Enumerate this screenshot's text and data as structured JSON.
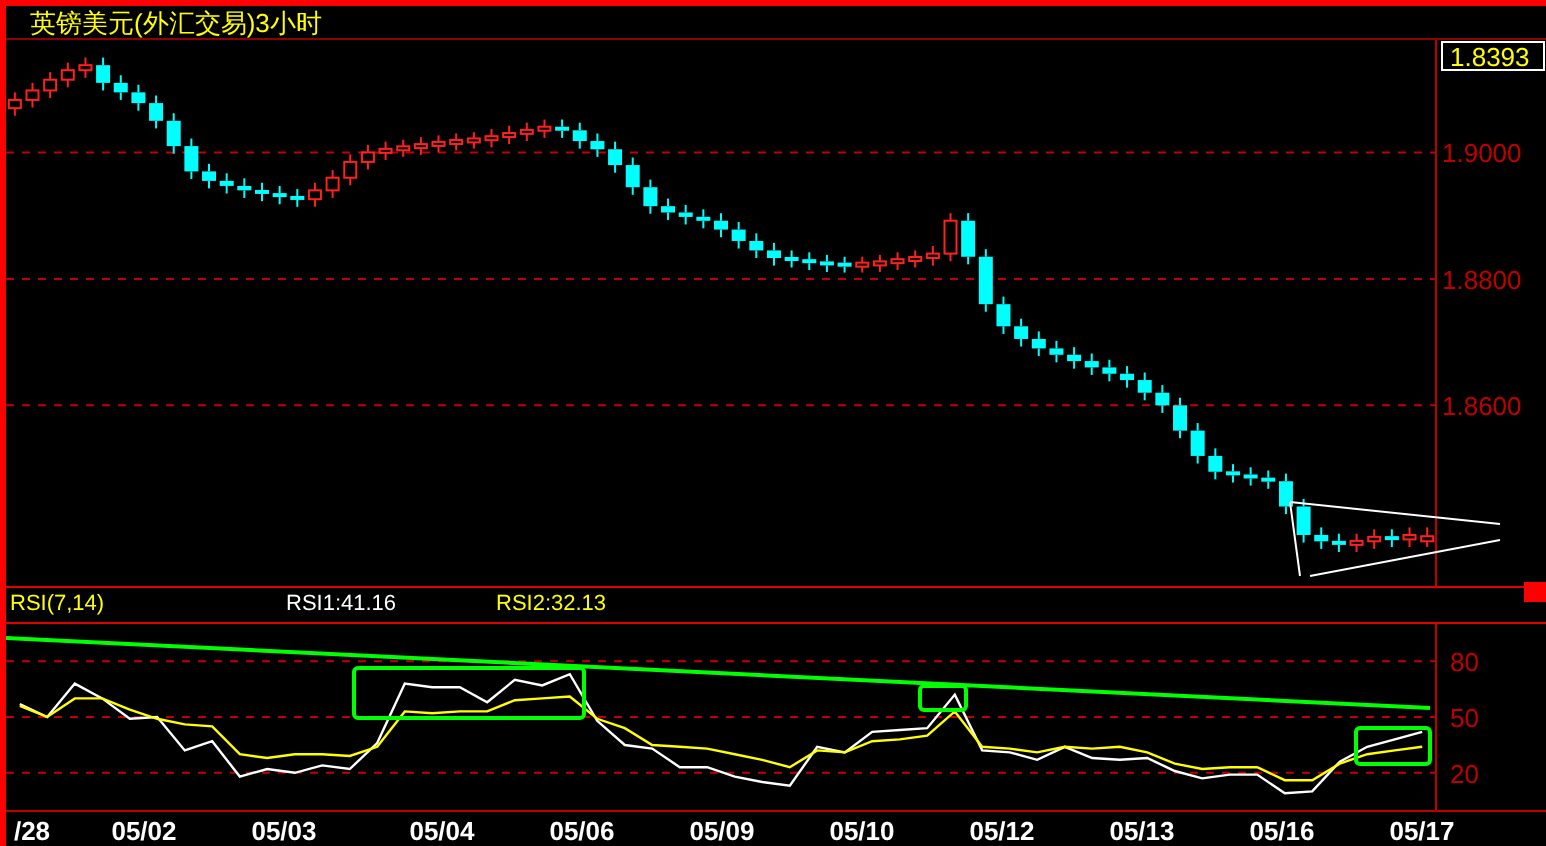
{
  "title": "英镑美元(外汇交易)3小时",
  "price_chart": {
    "current_price": "1.8393",
    "chart_data": {
      "type": "candlestick",
      "grid": true,
      "ylim": [
        1.83143,
        1.91778
      ],
      "yticks": [
        {
          "value": 1.9,
          "label": "1.9000"
        },
        {
          "value": 1.88,
          "label": "1.8800"
        },
        {
          "value": 1.86,
          "label": "1.8600"
        }
      ],
      "categories": [
        null,
        null,
        null,
        null,
        null,
        null,
        null,
        null,
        null,
        null,
        null,
        null,
        null,
        null,
        null,
        null,
        null,
        null,
        null,
        null,
        null,
        null,
        null,
        null,
        null,
        null,
        null,
        null,
        null,
        null,
        null,
        null,
        null,
        null,
        null,
        null,
        null,
        null,
        null,
        null,
        null,
        null,
        null,
        null,
        null,
        null,
        null,
        null,
        null,
        null,
        null,
        null,
        null,
        null,
        null,
        null,
        null,
        null,
        null,
        null,
        null,
        null,
        null,
        null,
        null,
        null,
        null,
        null,
        null,
        null,
        null,
        null,
        null,
        null,
        null,
        null,
        null,
        null,
        null,
        null,
        null
      ],
      "ohlc": [
        [
          1.907,
          1.9095,
          1.9058,
          1.9083
        ],
        [
          1.9083,
          1.911,
          1.9071,
          1.9098
        ],
        [
          1.9098,
          1.9127,
          1.9086,
          1.9115
        ],
        [
          1.9115,
          1.9142,
          1.9103,
          1.913
        ],
        [
          1.913,
          1.915,
          1.9118,
          1.9138
        ],
        [
          1.9138,
          1.915,
          1.9098,
          1.911
        ],
        [
          1.911,
          1.9122,
          1.9083,
          1.9095
        ],
        [
          1.9095,
          1.9107,
          1.9066,
          1.9078
        ],
        [
          1.9078,
          1.909,
          1.9038,
          1.905
        ],
        [
          1.905,
          1.9062,
          1.8998,
          1.901
        ],
        [
          1.901,
          1.9022,
          1.8958,
          1.897
        ],
        [
          1.897,
          1.8982,
          1.8943,
          1.8955
        ],
        [
          1.8955,
          1.8967,
          1.8935,
          1.8947
        ],
        [
          1.8947,
          1.8959,
          1.8928,
          1.894
        ],
        [
          1.894,
          1.8952,
          1.8923,
          1.8935
        ],
        [
          1.8935,
          1.8947,
          1.8918,
          1.893
        ],
        [
          1.893,
          1.8942,
          1.8914,
          1.8926
        ],
        [
          1.8926,
          1.8952,
          1.8914,
          1.894
        ],
        [
          1.894,
          1.8972,
          1.8928,
          1.896
        ],
        [
          1.896,
          1.8997,
          1.8948,
          1.8985
        ],
        [
          1.8985,
          1.9012,
          1.8973,
          1.9
        ],
        [
          1.9,
          1.9017,
          1.8988,
          1.9005
        ],
        [
          1.9005,
          1.902,
          1.8993,
          1.9008
        ],
        [
          1.9008,
          1.9024,
          1.8996,
          1.9012
        ],
        [
          1.9012,
          1.9027,
          1.9,
          1.9015
        ],
        [
          1.9015,
          1.903,
          1.9003,
          1.9018
        ],
        [
          1.9018,
          1.9032,
          1.9006,
          1.902
        ],
        [
          1.902,
          1.9037,
          1.9008,
          1.9025
        ],
        [
          1.9025,
          1.9042,
          1.9013,
          1.903
        ],
        [
          1.903,
          1.9047,
          1.9018,
          1.9035
        ],
        [
          1.9035,
          1.9052,
          1.9023,
          1.904
        ],
        [
          1.904,
          1.9052,
          1.9023,
          1.9035
        ],
        [
          1.9035,
          1.9047,
          1.9006,
          1.9018
        ],
        [
          1.9018,
          1.903,
          1.8993,
          1.9005
        ],
        [
          1.9005,
          1.9017,
          1.8968,
          1.898
        ],
        [
          1.898,
          1.8992,
          1.8933,
          1.8945
        ],
        [
          1.8945,
          1.8957,
          1.8903,
          1.8915
        ],
        [
          1.8915,
          1.8927,
          1.8893,
          1.8905
        ],
        [
          1.8905,
          1.8917,
          1.8886,
          1.8898
        ],
        [
          1.8898,
          1.891,
          1.888,
          1.8892
        ],
        [
          1.8892,
          1.8904,
          1.8866,
          1.8878
        ],
        [
          1.8878,
          1.889,
          1.8848,
          1.886
        ],
        [
          1.886,
          1.8872,
          1.8833,
          1.8845
        ],
        [
          1.8845,
          1.8857,
          1.8821,
          1.8833
        ],
        [
          1.8833,
          1.8845,
          1.8818,
          1.883
        ],
        [
          1.883,
          1.8842,
          1.8814,
          1.8826
        ],
        [
          1.8826,
          1.8838,
          1.8811,
          1.8823
        ],
        [
          1.8823,
          1.8835,
          1.881,
          1.8822
        ],
        [
          1.8822,
          1.8835,
          1.881,
          1.8823
        ],
        [
          1.8823,
          1.8838,
          1.8811,
          1.8826
        ],
        [
          1.8826,
          1.8842,
          1.8814,
          1.883
        ],
        [
          1.883,
          1.8845,
          1.8818,
          1.8833
        ],
        [
          1.8833,
          1.8852,
          1.8821,
          1.884
        ],
        [
          1.884,
          1.8904,
          1.8828,
          1.8892
        ],
        [
          1.8892,
          1.8904,
          1.8823,
          1.8835
        ],
        [
          1.8835,
          1.8847,
          1.8748,
          1.876
        ],
        [
          1.876,
          1.8772,
          1.8713,
          1.8725
        ],
        [
          1.8725,
          1.8737,
          1.8693,
          1.8705
        ],
        [
          1.8705,
          1.8717,
          1.8678,
          1.869
        ],
        [
          1.869,
          1.8702,
          1.8668,
          1.868
        ],
        [
          1.868,
          1.8692,
          1.8658,
          1.867
        ],
        [
          1.867,
          1.8682,
          1.8648,
          1.866
        ],
        [
          1.866,
          1.8672,
          1.8638,
          1.865
        ],
        [
          1.865,
          1.8662,
          1.8628,
          1.864
        ],
        [
          1.864,
          1.8652,
          1.8608,
          1.862
        ],
        [
          1.862,
          1.8632,
          1.8588,
          1.86
        ],
        [
          1.86,
          1.8612,
          1.8548,
          1.856
        ],
        [
          1.856,
          1.8572,
          1.8508,
          1.852
        ],
        [
          1.852,
          1.8532,
          1.8483,
          1.8495
        ],
        [
          1.8495,
          1.8507,
          1.8478,
          1.849
        ],
        [
          1.849,
          1.8502,
          1.8473,
          1.8485
        ],
        [
          1.8485,
          1.8497,
          1.8468,
          1.848
        ],
        [
          1.848,
          1.8492,
          1.8428,
          1.844
        ],
        [
          1.844,
          1.8452,
          1.8383,
          1.8395
        ],
        [
          1.8395,
          1.8407,
          1.8373,
          1.8385
        ],
        [
          1.8385,
          1.8397,
          1.8368,
          1.838
        ],
        [
          1.838,
          1.8397,
          1.8368,
          1.8385
        ],
        [
          1.8385,
          1.8404,
          1.8373,
          1.8392
        ],
        [
          1.8392,
          1.8404,
          1.8376,
          1.8388
        ],
        [
          1.8388,
          1.8407,
          1.8376,
          1.8395
        ],
        [
          1.8385,
          1.8407,
          1.8376,
          1.8393
        ]
      ]
    }
  },
  "rsi": {
    "label": "RSI(7,14)",
    "readings": [
      {
        "text": "RSI1:41.16",
        "color": "#ffffff"
      },
      {
        "text": "RSI2:32.13",
        "color": "#ffff00"
      }
    ],
    "chart_data": {
      "type": "line",
      "grid": true,
      "ylim": [
        0,
        100
      ],
      "yticks": [
        20,
        50,
        80
      ],
      "categories": [
        null,
        null,
        null,
        null,
        null,
        null,
        null,
        null,
        null,
        null,
        null,
        null,
        null,
        null,
        null,
        null,
        null,
        null,
        null,
        null,
        null,
        null,
        null,
        null,
        null,
        null,
        null,
        null,
        null,
        null,
        null,
        null,
        null,
        null,
        null,
        null,
        null,
        null,
        null,
        null,
        null,
        null,
        null,
        null,
        null,
        null,
        null,
        null,
        null,
        null,
        null,
        null
      ],
      "series": [
        {
          "color": "#ffffff",
          "values": [
            57,
            50,
            68,
            60,
            49,
            50,
            32,
            37,
            18,
            22,
            20,
            24,
            22,
            36,
            68,
            66,
            66,
            58,
            70,
            67,
            73,
            48,
            35,
            33,
            23,
            23,
            18,
            15,
            13,
            34,
            31,
            42,
            43,
            44,
            62,
            32,
            31,
            27,
            34,
            28,
            27,
            28,
            21,
            17,
            19,
            19,
            9,
            10,
            26,
            34,
            38,
            42
          ]
        },
        {
          "color": "#ffff00",
          "values": [
            56,
            50,
            60,
            60,
            54,
            49,
            46,
            45,
            30,
            28,
            30,
            30,
            29,
            34,
            53,
            52,
            53,
            53,
            59,
            60,
            61,
            49,
            44,
            35,
            34,
            33,
            30,
            27,
            23,
            32,
            31,
            37,
            38,
            40,
            53,
            34,
            33,
            31,
            34,
            33,
            34,
            31,
            25,
            22,
            23,
            23,
            16,
            16,
            25,
            30,
            32,
            34
          ]
        }
      ]
    }
  },
  "date_axis": [
    "/28",
    "05/02",
    "05/03",
    "05/04",
    "05/06",
    "05/09",
    "05/10",
    "05/12",
    "05/13",
    "05/16",
    "05/17"
  ]
}
